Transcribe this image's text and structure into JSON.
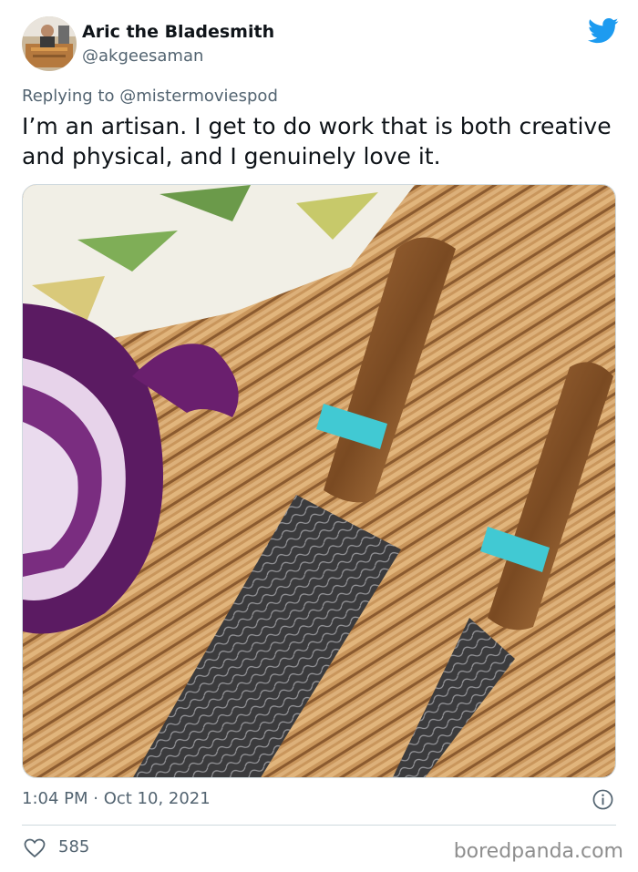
{
  "author": {
    "display_name": "Aric the Bladesmith",
    "handle": "@akgeesaman"
  },
  "reply": {
    "prefix": "Replying to",
    "mention": "@mistermoviespod"
  },
  "tweet": {
    "text": "I’m an artisan. I get to do work that is both creative and physical, and I genuinely love it.",
    "timestamp": "1:04 PM · Oct 10, 2021"
  },
  "engagement": {
    "likes": "585"
  },
  "watermark": "boredpanda.com",
  "icons": {
    "brand": "twitter-bird-icon",
    "info": "info-icon",
    "like": "heart-icon"
  },
  "colors": {
    "brand": "#1d9bf0",
    "text": "#0f1419",
    "secondary": "#536471"
  }
}
